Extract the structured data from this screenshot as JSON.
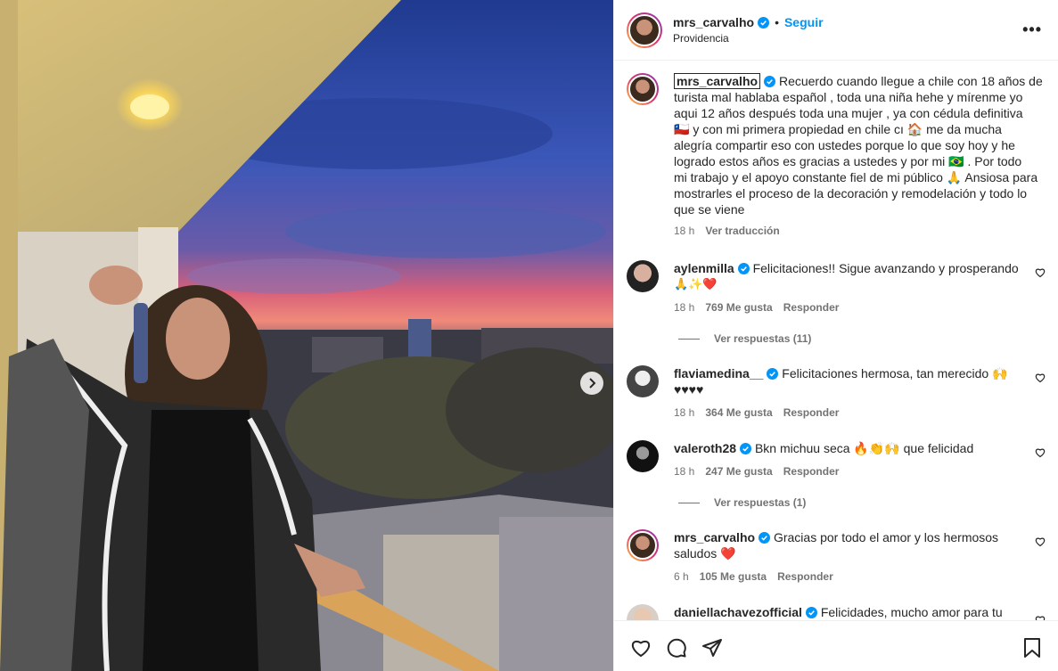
{
  "header": {
    "username": "mrs_carvalho",
    "separator": "•",
    "follow_label": "Seguir",
    "location": "Providencia",
    "more_label": "•••"
  },
  "caption": {
    "username": "mrs_carvalho",
    "lines": [
      "Recuerdo cuando llegue a chile con 18 años de",
      "turista mal hablaba español , toda una niña hehe y mírenme yo",
      "aqui 12 años después toda una mujer , ya con cédula definitiva",
      "🇨🇱 y con mi primera propiedad en chile cı 🏠 me da mucha",
      "alegría compartir eso con ustedes porque lo que soy hoy y he",
      "logrado estos años es gracias a ustedes y por mi 🇧🇷 . Por todo",
      "mi trabajo y el apoyo constante fiel de mi público 🙏 Ansiosa para",
      "mostrarles el proceso de la decoración y remodelación y todo lo",
      "que se viene"
    ],
    "time": "18 h",
    "translate": "Ver traducción"
  },
  "comments": [
    {
      "username": "aylenmilla",
      "verified": true,
      "text": "Felicitaciones!! Sigue avanzando y prosperando",
      "text2": "🙏✨❤️",
      "time": "18 h",
      "likes": "769 Me gusta",
      "reply": "Responder",
      "replies": "Ver respuestas (11)"
    },
    {
      "username": "flaviamedina__",
      "verified": true,
      "text": "Felicitaciones hermosa, tan merecido 🙌",
      "text2": "♥♥♥♥",
      "time": "18 h",
      "likes": "364 Me gusta",
      "reply": "Responder",
      "replies": ""
    },
    {
      "username": "valeroth28",
      "verified": true,
      "text": "Bkn michuu seca 🔥👏🙌 que felicidad",
      "text2": "",
      "time": "18 h",
      "likes": "247 Me gusta",
      "reply": "Responder",
      "replies": "Ver respuestas (1)"
    },
    {
      "username": "mrs_carvalho",
      "verified": true,
      "text": "Gracias por todo el amor y los hermosos",
      "text2": "saludos ❤️",
      "time": "6 h",
      "likes": "105 Me gusta",
      "reply": "Responder",
      "replies": ""
    },
    {
      "username": "daniellachavezofficial",
      "verified": true,
      "text": "Felicidades, mucho amor para tu",
      "text2": "",
      "time": "",
      "likes": "",
      "reply": "",
      "replies": ""
    }
  ],
  "colors": {
    "accent": "#0095f6",
    "verified": "#0095f6",
    "text": "#262626",
    "muted": "#737373"
  }
}
